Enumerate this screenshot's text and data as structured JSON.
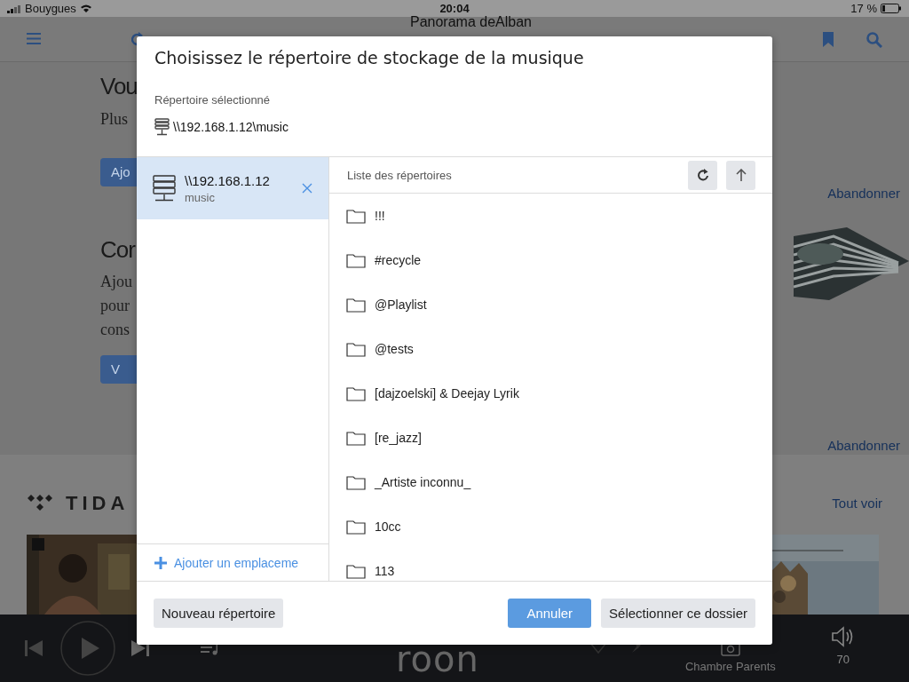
{
  "status_bar": {
    "carrier": "Bouygues",
    "time": "20:04",
    "battery": "17 %"
  },
  "app_bar": {
    "title": "Panorama deAlban"
  },
  "background": {
    "sections": [
      {
        "heading": "Vou",
        "lines": [
          "Plus"
        ],
        "button": "Ajo",
        "link": "Abandonner"
      },
      {
        "heading": "Cor",
        "lines": [
          "Ajou",
          "pour",
          "cons"
        ],
        "button": "V",
        "link": "Abandonner"
      }
    ],
    "tidal": {
      "logo": "TIDA",
      "link": "Tout voir"
    }
  },
  "dialog": {
    "title": "Choisissez le répertoire de stockage de la musique",
    "selected_label": "Répertoire sélectionné",
    "selected_path": "\\\\192.168.1.12\\music",
    "locations": [
      {
        "name": "\\\\192.168.1.12",
        "share": "music",
        "selected": true
      }
    ],
    "add_location": "Ajouter un emplaceme",
    "list_header": "Liste des répertoires",
    "folders": [
      "!!!",
      "#recycle",
      "@Playlist",
      "@tests",
      "[dajzoelski] & Deejay Lyrik",
      "[re_jazz]",
      "_Artiste inconnu_",
      "10cc",
      "113"
    ],
    "buttons": [
      {
        "label": "Nouveau répertoire",
        "kind": "secondary"
      },
      {
        "label": "Annuler",
        "kind": "primary"
      },
      {
        "label": "Sélectionner ce dossier",
        "kind": "secondary"
      }
    ]
  },
  "player": {
    "logo": "roon",
    "zone": "Chambre Parents",
    "volume": "70"
  }
}
